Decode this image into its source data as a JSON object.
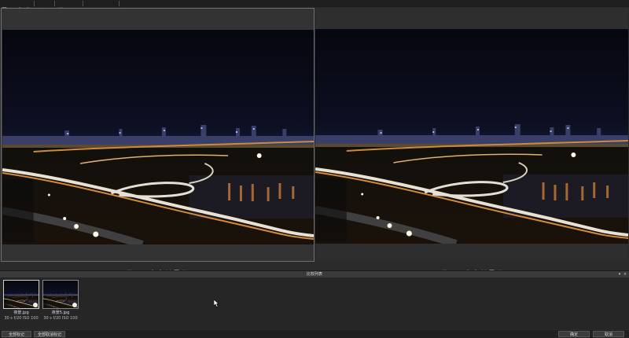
{
  "toolbar": {
    "icons": [
      "grid-icon",
      "circle-icon",
      "zoom-in-icon",
      "zoom-out-icon",
      "rotate-icon",
      "triangle-icon",
      "document-icon",
      "histogram-icon",
      "menu-icon",
      "copy-icon",
      "compare-icon",
      "layers-icon",
      "split-icon",
      "info-icon"
    ]
  },
  "pane_tools": {
    "icons": [
      "save-icon",
      "circle-icon",
      "circle-icon",
      "zoom-in-icon",
      "zoom-out-icon",
      "delete-icon",
      "grid-icon",
      "edit-icon"
    ]
  },
  "filmstrip": {
    "title": "比较列表"
  },
  "thumbnails": [
    {
      "name": "夜景.jpg",
      "meta": "30 s  f/20  ISO 100"
    },
    {
      "name": "夜景5.jpg",
      "meta": "30 s  f/20  ISO 100"
    }
  ],
  "buttons": {
    "mark_all": "全部标记",
    "unmark_all": "全部取消标记",
    "ok": "确定",
    "cancel": "取消"
  }
}
